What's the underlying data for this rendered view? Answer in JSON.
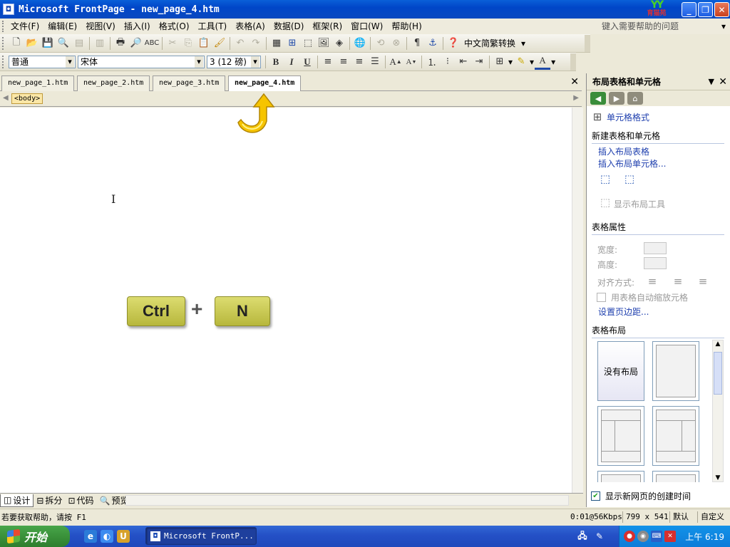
{
  "window": {
    "title": "Microsoft FrontPage - new_page_4.htm",
    "logo_text": "育猫苑",
    "minimize": "_",
    "maximize": "❐",
    "close": "✕"
  },
  "menu": {
    "items": [
      "文件(F)",
      "编辑(E)",
      "视图(V)",
      "插入(I)",
      "格式(O)",
      "工具(T)",
      "表格(A)",
      "数据(D)",
      "框架(R)",
      "窗口(W)",
      "帮助(H)"
    ],
    "help_placeholder": "键入需要帮助的问题"
  },
  "toolbar1": {
    "convert_label": "中文简繁转换"
  },
  "toolbar2": {
    "style": "普通",
    "font": "宋体",
    "size": "3 (12 磅)",
    "bold": "B",
    "italic": "I",
    "underline": "U"
  },
  "doc_tabs": [
    "new_page_1.htm",
    "new_page_2.htm",
    "new_page_3.htm",
    "new_page_4.htm"
  ],
  "doc_tab_close": "✕",
  "tag_selector": "<body>",
  "shortcut": {
    "key1": "Ctrl",
    "plus": "+",
    "key2": "N"
  },
  "view_tabs": [
    "设计",
    "拆分",
    "代码",
    "预览"
  ],
  "taskpane": {
    "title": "布局表格和单元格",
    "cell_format": "单元格格式",
    "section_new": "新建表格和单元格",
    "insert_table": "插入布局表格",
    "insert_cell": "插入布局单元格...",
    "show_tools": "显示布局工具",
    "section_props": "表格属性",
    "width_label": "宽度:",
    "height_label": "高度:",
    "align_label": "对齐方式:",
    "autoscale": "用表格自动缩放元格",
    "page_margins": "设置页边距...",
    "section_layout": "表格布局",
    "no_layout": "没有布局",
    "show_created_time": "显示新网页的创建时间"
  },
  "status": {
    "help": "若要获取帮助，请按 F1",
    "speed": "0:01@56Kbps",
    "size": "799 x 541",
    "mode1": "默认",
    "mode2": "自定义"
  },
  "taskbar": {
    "start": "开始",
    "task": "Microsoft FrontP...",
    "clock": "上午 6:19"
  }
}
